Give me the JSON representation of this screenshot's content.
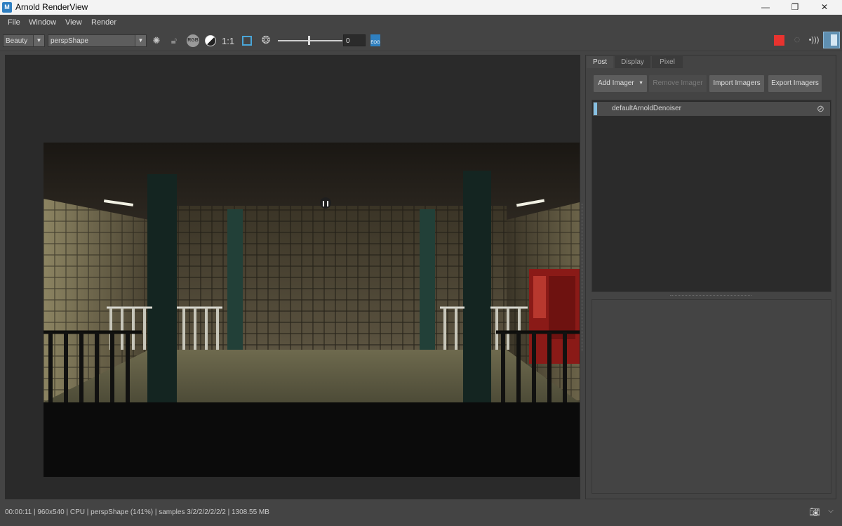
{
  "window": {
    "title": "Arnold RenderView",
    "app_icon_letter": "M",
    "minimize": "—",
    "restore": "❐",
    "close": "✕"
  },
  "menu": {
    "items": [
      "File",
      "Window",
      "View",
      "Render"
    ]
  },
  "toolbar": {
    "aov_value": "Beauty",
    "camera_value": "perspShape",
    "rgb_label": "RGB",
    "ratio_label": "1:1",
    "exposure_value": "0",
    "ocio_label": "EOG"
  },
  "panel": {
    "tabs": [
      "Post",
      "Display",
      "Pixel"
    ],
    "active_tab": "Post",
    "buttons": {
      "add_imager": "Add Imager",
      "remove_imager": "Remove Imager",
      "import_imagers": "Import Imagers",
      "export_imagers": "Export Imagers"
    },
    "imagers": [
      "defaultArnoldDenoiser"
    ]
  },
  "status": {
    "text": "00:00:11 | 960x540 | CPU | perspShape (141%) | samples 3/2/2/2/2/2/2 | 1308.55 MB"
  },
  "colors": {
    "stop_button": "#e8332f",
    "accent": "#4aa6d8",
    "imager_marker": "#87c0e2"
  },
  "icons": [
    "app-icon",
    "chevron-down-icon",
    "sun-icon",
    "lock-icon",
    "rgb-icon",
    "half-circle-icon",
    "region-icon",
    "aperture-icon",
    "ocio-icon",
    "stop-icon",
    "refresh-icon",
    "ipr-icon",
    "panel-toggle-icon",
    "disable-icon",
    "camera-icon"
  ]
}
